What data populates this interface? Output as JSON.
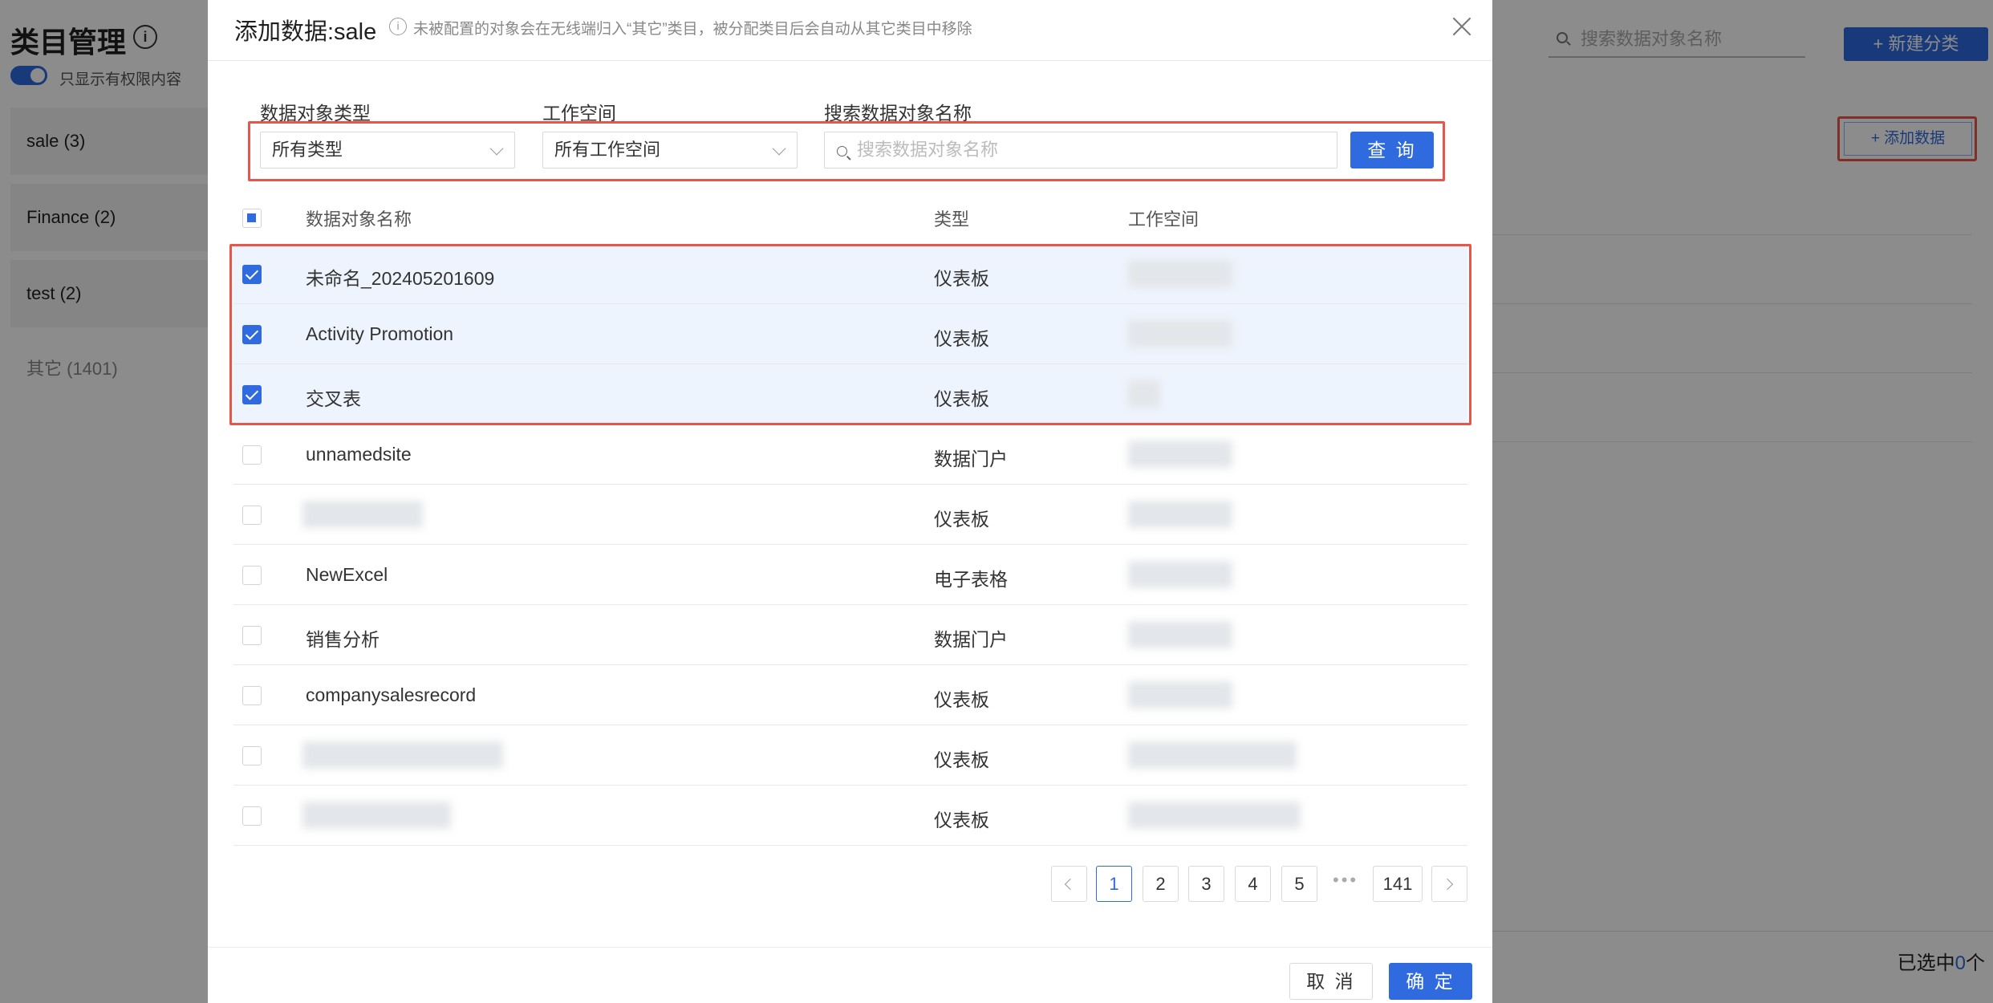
{
  "background": {
    "title": "类目管理",
    "info_icon": "info-icon",
    "toggle_label": "只显示有权限内容",
    "categories": [
      {
        "label": "sale (3)"
      },
      {
        "label": "Finance (2)"
      },
      {
        "label": "test (2)"
      },
      {
        "label": "其它 (1401)"
      }
    ],
    "search_placeholder": "搜索数据对象名称",
    "new_category_label": "+ 新建分类",
    "add_data_label": "+ 添加数据",
    "selected_prefix": "已选中",
    "selected_count": "0",
    "selected_suffix": "个"
  },
  "modal": {
    "title": "添加数据:sale",
    "tip": "未被配置的对象会在无线端归入“其它”类目，被分配类目后会自动从其它类目中移除",
    "filters": {
      "type_label": "数据对象类型",
      "type_value": "所有类型",
      "workspace_label": "工作空间",
      "workspace_value": "所有工作空间",
      "search_label": "搜索数据对象名称",
      "search_placeholder": "搜索数据对象名称",
      "query_label": "查 询"
    },
    "table": {
      "columns": [
        "数据对象名称",
        "类型",
        "工作空间"
      ],
      "rows": [
        {
          "name": "未命名_202405201609",
          "type": "仪表板",
          "checked": true
        },
        {
          "name": "Activity Promotion",
          "type": "仪表板",
          "checked": true
        },
        {
          "name": "交叉表",
          "type": "仪表板",
          "checked": true
        },
        {
          "name": "unnamedsite",
          "type": "数据门户",
          "checked": false
        },
        {
          "name": "",
          "type": "仪表板",
          "checked": false
        },
        {
          "name": "NewExcel",
          "type": "电子表格",
          "checked": false
        },
        {
          "name": "销售分析",
          "type": "数据门户",
          "checked": false
        },
        {
          "name": "companysalesrecord",
          "type": "仪表板",
          "checked": false
        },
        {
          "name": "",
          "type": "仪表板",
          "checked": false
        },
        {
          "name": "",
          "type": "仪表板",
          "checked": false
        }
      ]
    },
    "pagination": {
      "pages": [
        "1",
        "2",
        "3",
        "4",
        "5"
      ],
      "current": "1",
      "ellipsis": "•••",
      "last": "141"
    },
    "cancel_label": "取 消",
    "ok_label": "确 定"
  },
  "colors": {
    "primary": "#2f6bdf",
    "highlight": "#e8554a",
    "selected_row": "#eef4fd"
  }
}
